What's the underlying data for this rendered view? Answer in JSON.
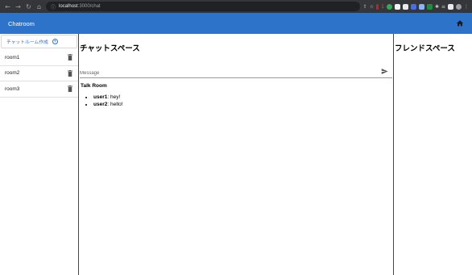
{
  "browser": {
    "url_host": "localhost",
    "url_path": ":3000/chat",
    "extension_badge": "1"
  },
  "header": {
    "title": "Chatroom"
  },
  "sidebar": {
    "create_label": "チャットルーム作成",
    "rooms": [
      {
        "name": "room1"
      },
      {
        "name": "room2"
      },
      {
        "name": "room3"
      }
    ]
  },
  "chat": {
    "heading": "チャットスペース",
    "input_placeholder": "Message",
    "room_title": "Talk Room",
    "messages": [
      {
        "user": "user1",
        "text": "hey!"
      },
      {
        "user": "user2",
        "text": "hello!"
      }
    ]
  },
  "friends": {
    "heading": "フレンドスペース"
  },
  "colors": {
    "header": "#2d73c9",
    "browser_chrome": "#35363a"
  }
}
